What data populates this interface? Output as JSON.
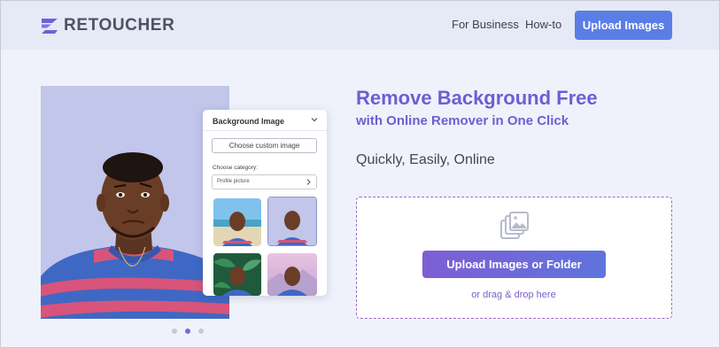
{
  "header": {
    "logo_text": "RETOUCHER",
    "nav": [
      {
        "label": "For Business"
      },
      {
        "label": "How-to"
      }
    ],
    "upload_button": "Upload Images"
  },
  "hero": {
    "title": "Remove Background Free",
    "subtitle": "with Online Remover in One Click",
    "tagline": "Quickly, Easily, Online",
    "upload_button": "Upload Images or Folder",
    "drag_text": "or drag & drop here"
  },
  "background_card": {
    "title": "Background Image",
    "custom_button": "Choose custom image",
    "category_label": "Choose category:",
    "category_value": "Profile picture",
    "thumbnails": [
      "beach",
      "lavender",
      "leaves",
      "pink-sky"
    ]
  },
  "carousel": {
    "slides": 3,
    "active_index": 1
  },
  "colors": {
    "accent": "#5b7ee6",
    "headline": "#6c5fd2",
    "dropzone_border": "#9a6ac9",
    "header_bg": "#e6e9f6"
  },
  "icons": [
    "logo-icon",
    "chevron-down-icon",
    "chevron-right-icon",
    "gallery-icon"
  ]
}
